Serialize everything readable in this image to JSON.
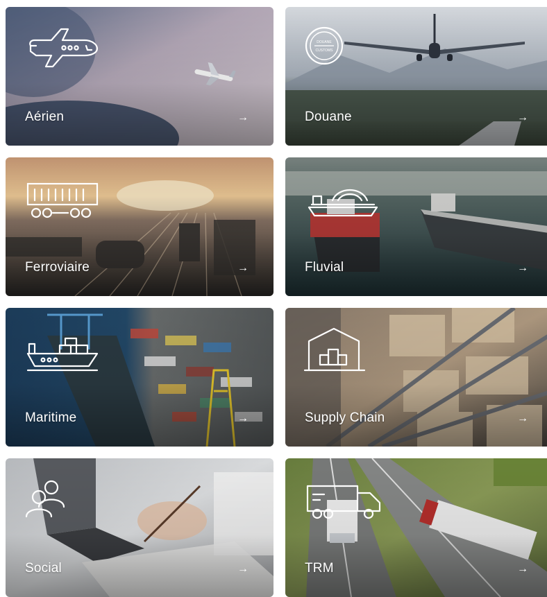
{
  "cards": [
    {
      "label": "Aérien",
      "arrow": "→",
      "icon": "airplane-icon",
      "colors": [
        "#b8a9b9",
        "#6c6f8a",
        "#3b4d6a"
      ]
    },
    {
      "label": "Douane",
      "arrow": "→",
      "icon": "douane-customs-stamp-icon",
      "icon_text_top": "DOUANE",
      "icon_text_bottom": "CUSTOMS",
      "colors": [
        "#c8cfd8",
        "#5b6c5a",
        "#3d4739"
      ]
    },
    {
      "label": "Ferroviaire",
      "arrow": "→",
      "icon": "train-wagon-icon",
      "colors": [
        "#e8b783",
        "#6b5c4f",
        "#2c2a2b"
      ]
    },
    {
      "label": "Fluvial",
      "arrow": "→",
      "icon": "river-barge-icon",
      "colors": [
        "#8b9894",
        "#3f5753",
        "#1f3235"
      ]
    },
    {
      "label": "Maritime",
      "arrow": "→",
      "icon": "cargo-ship-icon",
      "colors": [
        "#2d4d6b",
        "#1f3d5a",
        "#54666d"
      ]
    },
    {
      "label": "Supply Chain",
      "arrow": "→",
      "icon": "warehouse-icon",
      "colors": [
        "#b9a48c",
        "#6d5a4a",
        "#3f3a36"
      ]
    },
    {
      "label": "Social",
      "arrow": "→",
      "icon": "people-icon",
      "colors": [
        "#d9dce0",
        "#a7a9ae",
        "#5d5f63"
      ]
    },
    {
      "label": "TRM",
      "arrow": "→",
      "icon": "truck-icon",
      "colors": [
        "#7b8f46",
        "#8b8d8c",
        "#4f5350"
      ]
    }
  ]
}
